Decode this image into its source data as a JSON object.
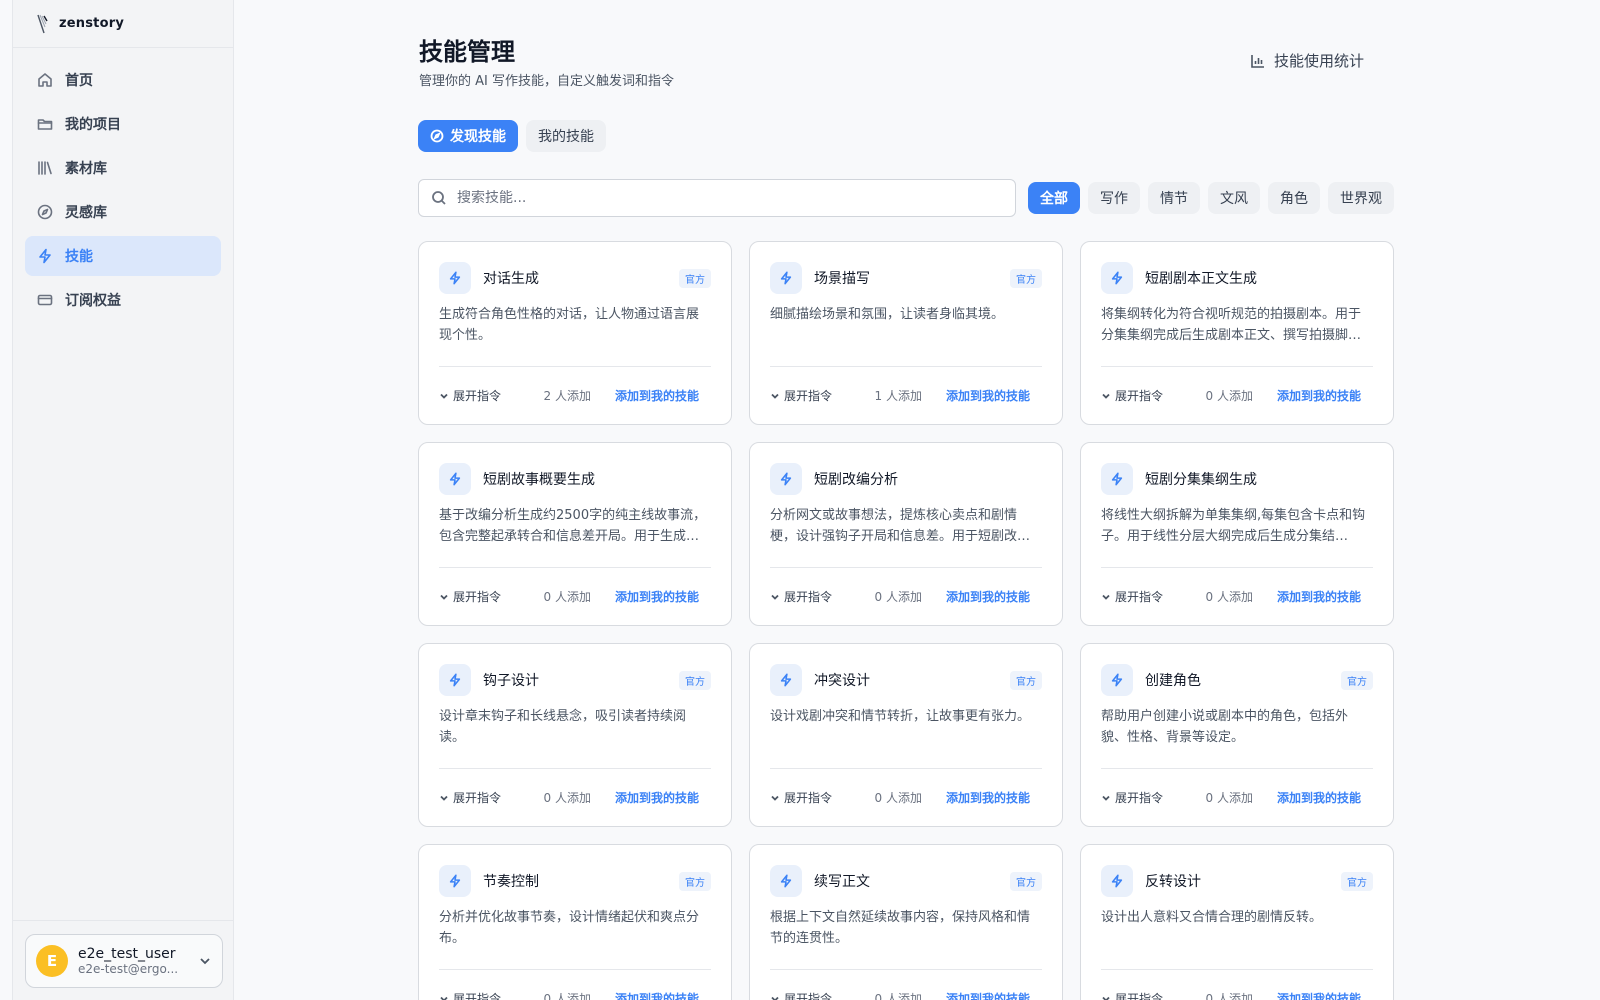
{
  "brand": {
    "name": "zenstory",
    "logo_icon": "feather-logo-icon"
  },
  "sidebar": {
    "items": [
      {
        "label": "首页",
        "icon": "home-icon",
        "active": false
      },
      {
        "label": "我的项目",
        "icon": "folder-icon",
        "active": false
      },
      {
        "label": "素材库",
        "icon": "library-icon",
        "active": false
      },
      {
        "label": "灵感库",
        "icon": "compass-icon",
        "active": false
      },
      {
        "label": "技能",
        "icon": "lightning-icon",
        "active": true
      },
      {
        "label": "订阅权益",
        "icon": "card-icon",
        "active": false
      }
    ]
  },
  "user": {
    "initial": "E",
    "name": "e2e_test_user",
    "email": "e2e-test@ergo..."
  },
  "header": {
    "title": "技能管理",
    "subtitle": "管理你的 AI 写作技能，自定义触发词和指令",
    "stats_label": "技能使用统计"
  },
  "tabs": [
    {
      "label": "发现技能",
      "active": true
    },
    {
      "label": "我的技能",
      "active": false
    }
  ],
  "search": {
    "placeholder": "搜索技能..."
  },
  "categories": [
    {
      "label": "全部",
      "active": true
    },
    {
      "label": "写作",
      "active": false
    },
    {
      "label": "情节",
      "active": false
    },
    {
      "label": "文风",
      "active": false
    },
    {
      "label": "角色",
      "active": false
    },
    {
      "label": "世界观",
      "active": false
    }
  ],
  "card_labels": {
    "badge": "官方",
    "expand": "展开指令",
    "add": "添加到我的技能"
  },
  "cards": [
    {
      "title": "对话生成",
      "desc": "生成符合角色性格的对话，让人物通过语言展现个性。",
      "badge": "官方",
      "expand": "展开指令",
      "added": "2 人添加",
      "add": "添加到我的技能"
    },
    {
      "title": "场景描写",
      "desc": "细腻描绘场景和氛围，让读者身临其境。",
      "badge": "官方",
      "expand": "展开指令",
      "added": "1 人添加",
      "add": "添加到我的技能"
    },
    {
      "title": "短剧剧本正文生成",
      "desc": "将集纲转化为符合视听规范的拍摄剧本。用于分集集纲完成后生成剧本正文、撰写拍摄脚…",
      "badge": "",
      "expand": "展开指令",
      "added": "0 人添加",
      "add": "添加到我的技能"
    },
    {
      "title": "短剧故事概要生成",
      "desc": "基于改编分析生成约2500字的纯主线故事流，包含完整起承转合和信息差开局。用于生成故…",
      "badge": "",
      "expand": "展开指令",
      "added": "0 人添加",
      "add": "添加到我的技能"
    },
    {
      "title": "短剧改编分析",
      "desc": "分析网文或故事想法，提炼核心卖点和剧情梗，设计强钩子开局和信息差。用于短剧改编…",
      "badge": "",
      "expand": "展开指令",
      "added": "0 人添加",
      "add": "添加到我的技能"
    },
    {
      "title": "短剧分集集纲生成",
      "desc": "将线性大纲拆解为单集集纲,每集包含卡点和钩子。用于线性分层大纲完成后生成分集结构、…",
      "badge": "",
      "expand": "展开指令",
      "added": "0 人添加",
      "add": "添加到我的技能"
    },
    {
      "title": "钩子设计",
      "desc": "设计章末钩子和长线悬念，吸引读者持续阅读。",
      "badge": "官方",
      "expand": "展开指令",
      "added": "0 人添加",
      "add": "添加到我的技能"
    },
    {
      "title": "冲突设计",
      "desc": "设计戏剧冲突和情节转折，让故事更有张力。",
      "badge": "官方",
      "expand": "展开指令",
      "added": "0 人添加",
      "add": "添加到我的技能"
    },
    {
      "title": "创建角色",
      "desc": "帮助用户创建小说或剧本中的角色，包括外貌、性格、背景等设定。",
      "badge": "官方",
      "expand": "展开指令",
      "added": "0 人添加",
      "add": "添加到我的技能"
    },
    {
      "title": "节奏控制",
      "desc": "分析并优化故事节奏，设计情绪起伏和爽点分布。",
      "badge": "官方",
      "expand": "展开指令",
      "added": "0 人添加",
      "add": "添加到我的技能"
    },
    {
      "title": "续写正文",
      "desc": "根据上下文自然延续故事内容，保持风格和情节的连贯性。",
      "badge": "官方",
      "expand": "展开指令",
      "added": "0 人添加",
      "add": "添加到我的技能"
    },
    {
      "title": "反转设计",
      "desc": "设计出人意料又合情合理的剧情反转。",
      "badge": "官方",
      "expand": "展开指令",
      "added": "0 人添加",
      "add": "添加到我的技能"
    }
  ]
}
